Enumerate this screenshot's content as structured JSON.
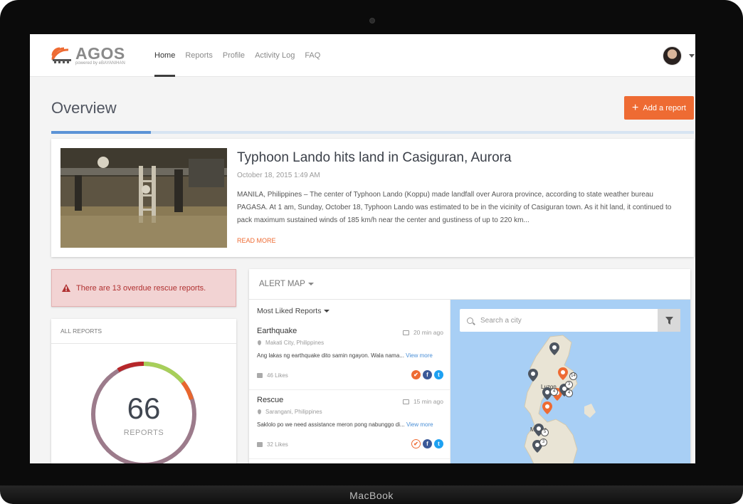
{
  "device": {
    "brand": "MacBook"
  },
  "navbar": {
    "logo_text": "AGOS",
    "logo_sub": "powered by eBAYANIHAN",
    "items": [
      {
        "label": "Home",
        "active": true
      },
      {
        "label": "Reports",
        "active": false
      },
      {
        "label": "Profile",
        "active": false
      },
      {
        "label": "Activity Log",
        "active": false
      },
      {
        "label": "FAQ",
        "active": false
      }
    ]
  },
  "page": {
    "title": "Overview",
    "add_button_label": "Add a report",
    "progress_fraction": 0.155
  },
  "featured": {
    "title": "Typhoon Lando hits land in Casiguran, Aurora",
    "date": "October 18, 2015 1:49 AM",
    "body": "MANILA, Philippines – The center of Typhoon Lando (Koppu) made landfall over Aurora province, according to state weather bureau PAGASA. At 1 am, Sunday, October 18, Typhoon Lando was estimated to be in the vicinity of Casiguran town. As it hit land, it continued to pack maximum sustained winds of 185 km/h near the center and gustiness of up to 220 km...",
    "read_more": "READ MORE"
  },
  "alert": {
    "text": "There are 13 overdue rescue reports."
  },
  "all_reports": {
    "header": "ALL REPORTS",
    "total": "66",
    "total_label": "REPORTS",
    "colors": {
      "main": "#9c7b8b",
      "red": "#b7272a",
      "green": "#a7cf5a",
      "orange": "#e8662d"
    }
  },
  "alert_map": {
    "header": "ALERT MAP",
    "filter_label": "Most Liked Reports",
    "search_placeholder": "Search a city",
    "reports": [
      {
        "title": "Earthquake",
        "time": "20 min ago",
        "location": "Makati City, Philippines",
        "text": "Ang lakas ng earthquake dito samin ngayon. Wala nama...",
        "view_more": "View more",
        "likes": "46 Likes"
      },
      {
        "title": "Rescue",
        "time": "15 min ago",
        "location": "Sarangani, Philippines",
        "text": "Saklolo po we need assistance meron pong nabunggo di...",
        "view_more": "View more",
        "likes": "32 Likes"
      }
    ],
    "map_labels": {
      "luzon": "Luzon",
      "manila": "Manila"
    },
    "pin_counts": [
      "14",
      "3",
      "4",
      "4",
      "5",
      "3"
    ]
  },
  "colors": {
    "accent": "#ee6b33",
    "progress": "#5b93d6",
    "alert_bg": "#f2d3d3"
  }
}
